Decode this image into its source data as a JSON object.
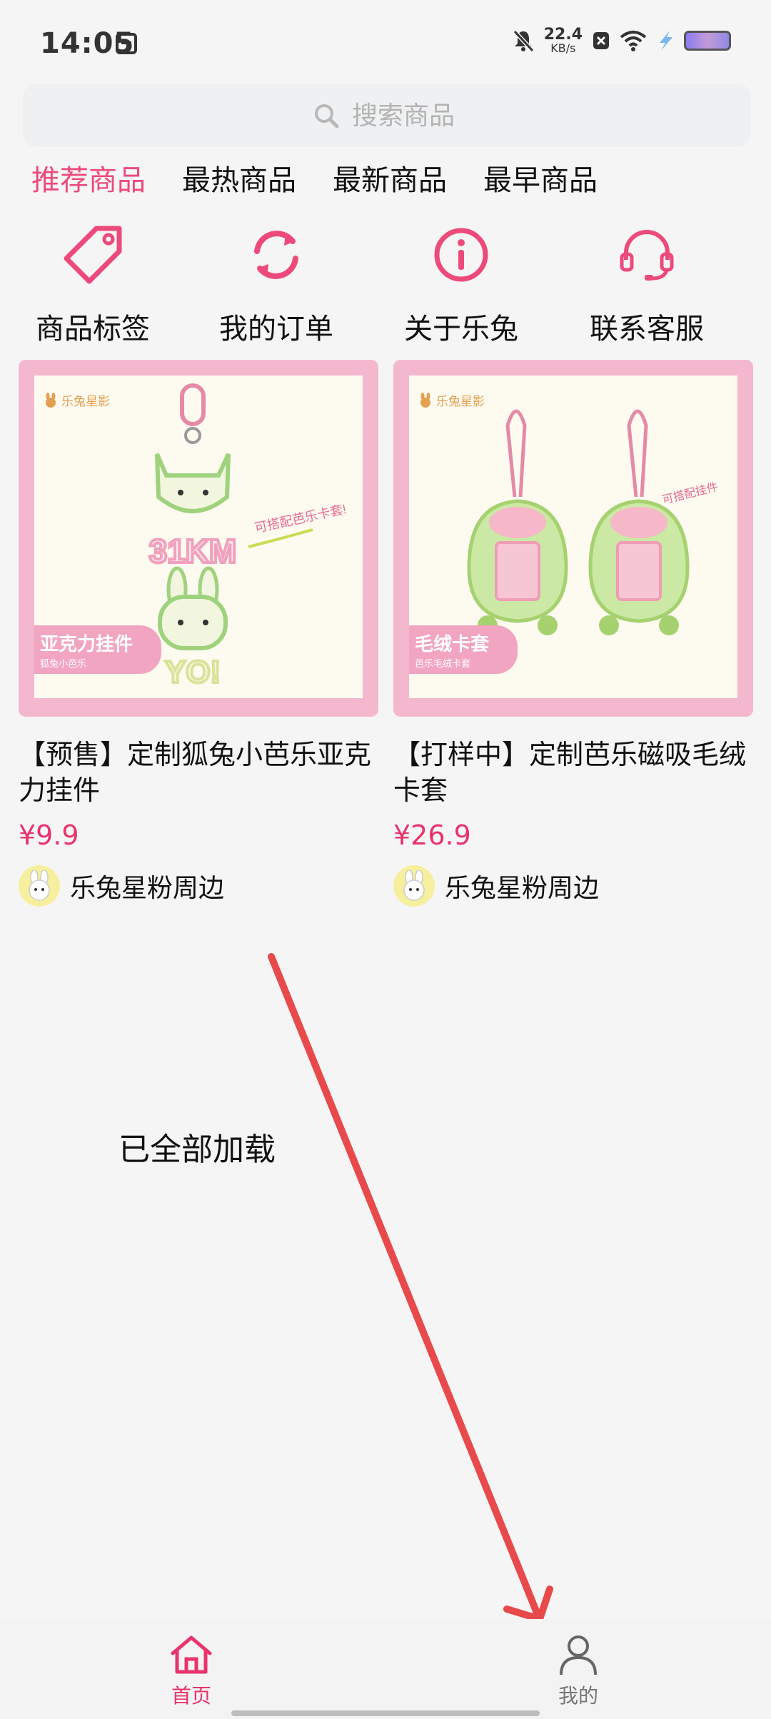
{
  "status_bar": {
    "time": "14:05",
    "net_speed_value": "22.4",
    "net_speed_unit": "KB/s",
    "icons": [
      "notification-icon",
      "mute-icon",
      "close-box-icon",
      "wifi-icon",
      "bolt-icon",
      "battery-icon"
    ]
  },
  "search": {
    "placeholder": "搜索商品",
    "icon": "search-icon"
  },
  "tabs": [
    {
      "label": "推荐商品",
      "active": true
    },
    {
      "label": "最热商品",
      "active": false
    },
    {
      "label": "最新商品",
      "active": false
    },
    {
      "label": "最早商品",
      "active": false
    }
  ],
  "shortcuts": [
    {
      "label": "商品标签",
      "icon": "tag-icon"
    },
    {
      "label": "我的订单",
      "icon": "refresh-icon"
    },
    {
      "label": "关于乐兔",
      "icon": "info-icon"
    },
    {
      "label": "联系客服",
      "icon": "headset-icon"
    }
  ],
  "products": [
    {
      "title": "【预售】定制狐兔小芭乐亚克力挂件",
      "price": "¥9.9",
      "seller": "乐兔星粉周边",
      "image_brand": "乐兔星影",
      "image_tag": "亚克力挂件",
      "image_tag_sub": "狐兔小芭乐",
      "image_text_1": "31KM",
      "image_text_2": "YO!",
      "image_note": "可搭配芭乐卡套!"
    },
    {
      "title": "【打样中】定制芭乐磁吸毛绒卡套",
      "price": "¥26.9",
      "seller": "乐兔星粉周边",
      "image_brand": "乐兔星影",
      "image_tag": "毛绒卡套",
      "image_tag_sub": "芭乐毛绒卡套",
      "image_note": "可搭配挂件"
    }
  ],
  "list_end_text": "已全部加载",
  "bottom_nav": [
    {
      "label": "首页",
      "icon": "home-icon",
      "active": true
    },
    {
      "label": "我的",
      "icon": "person-icon",
      "active": false
    }
  ],
  "colors": {
    "accent": "#ec4a7b",
    "price": "#e8336b",
    "arrow": "#e8494a"
  }
}
